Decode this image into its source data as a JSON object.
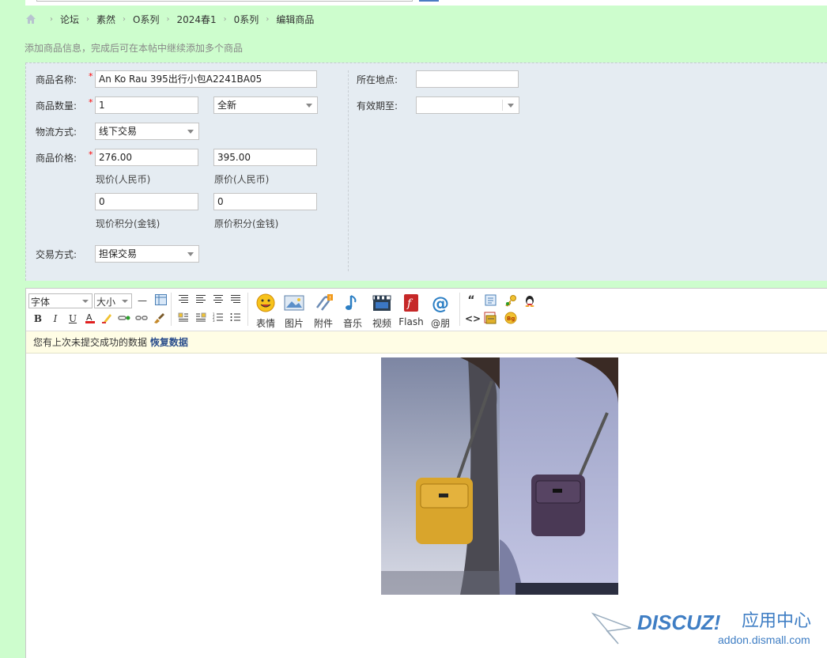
{
  "breadcrumb": {
    "items": [
      "论坛",
      "素然",
      "O系列",
      "2024春1",
      "0系列",
      "编辑商品"
    ]
  },
  "hint": "添加商品信息，完成后可在本帖中继续添加多个商品",
  "form": {
    "name_label": "商品名称:",
    "name_value": "An Ko Rau 395出行小包A2241BA05",
    "qty_label": "商品数量:",
    "qty_value": "1",
    "condition_value": "全新",
    "shipping_label": "物流方式:",
    "shipping_value": "线下交易",
    "price_label": "商品价格:",
    "price_now": "276.00",
    "price_now_caption": "现价(人民币)",
    "price_orig": "395.00",
    "price_orig_caption": "原价(人民币)",
    "credit_now": "0",
    "credit_now_caption": "现价积分(金钱)",
    "credit_orig": "0",
    "credit_orig_caption": "原价积分(金钱)",
    "trade_label": "交易方式:",
    "trade_value": "担保交易",
    "location_label": "所在地点:",
    "location_value": "",
    "expiry_label": "有效期至:",
    "expiry_value": ""
  },
  "toolbar": {
    "font_label": "字体",
    "size_label": "大小",
    "emoji_label": "表情",
    "image_label": "图片",
    "attach_label": "附件",
    "music_label": "音乐",
    "video_label": "视频",
    "flash_label": "Flash",
    "at_label": "@朋"
  },
  "notice": {
    "text": "您有上次未提交成功的数据 ",
    "link": "恢复数据"
  },
  "watermark": {
    "brand": "DISCUZ!",
    "cn": "应用中心",
    "url": "addon.dismall.com"
  },
  "colors": {
    "page_bg": "#cdfdcd",
    "form_bg": "#e5ecf2",
    "notice_bg": "#fffde5",
    "link": "#2b4e8c",
    "required": "#ff0000"
  }
}
